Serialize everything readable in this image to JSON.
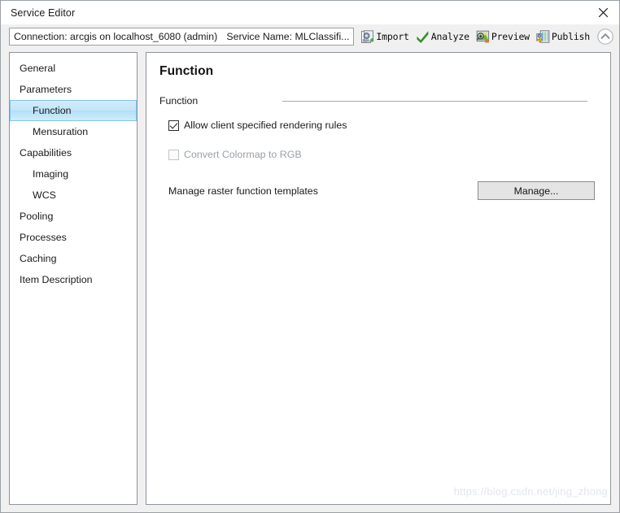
{
  "window": {
    "title": "Service Editor",
    "close_icon": "close-icon"
  },
  "toolbar": {
    "connection_label": "Connection: arcgis on localhost_6080 (admin)",
    "service_name_label": "Service Name: MLClassifi...",
    "buttons": [
      {
        "label": "Import",
        "icon": "import-icon"
      },
      {
        "label": "Analyze",
        "icon": "analyze-check-icon"
      },
      {
        "label": "Preview",
        "icon": "preview-icon"
      },
      {
        "label": "Publish",
        "icon": "publish-icon"
      }
    ],
    "collapse_icon": "chevron-up-circle-icon"
  },
  "sidebar": {
    "items": [
      {
        "label": "General",
        "indent": false,
        "selected": false
      },
      {
        "label": "Parameters",
        "indent": false,
        "selected": false
      },
      {
        "label": "Function",
        "indent": true,
        "selected": true
      },
      {
        "label": "Mensuration",
        "indent": true,
        "selected": false
      },
      {
        "label": "Capabilities",
        "indent": false,
        "selected": false
      },
      {
        "label": "Imaging",
        "indent": true,
        "selected": false
      },
      {
        "label": "WCS",
        "indent": true,
        "selected": false
      },
      {
        "label": "Pooling",
        "indent": false,
        "selected": false
      },
      {
        "label": "Processes",
        "indent": false,
        "selected": false
      },
      {
        "label": "Caching",
        "indent": false,
        "selected": false
      },
      {
        "label": "Item Description",
        "indent": false,
        "selected": false
      }
    ]
  },
  "panel": {
    "title": "Function",
    "group_label": "Function",
    "checkbox_rendering_rules": {
      "label": "Allow client specified rendering rules",
      "checked": true,
      "enabled": true
    },
    "checkbox_convert_colormap": {
      "label": "Convert Colormap to RGB",
      "checked": false,
      "enabled": false
    },
    "manage_templates": {
      "label": "Manage raster function templates",
      "button_label": "Manage..."
    }
  },
  "watermark": {
    "text": "https://blog.csdn.net/jing_zhong"
  },
  "colors": {
    "selection_blue": "#b3def6",
    "selection_border": "#7fc4e8",
    "window_chrome": "#f0f0f0",
    "panel_border": "#8f959e",
    "button_face": "#e4e4e4",
    "disabled_text": "#9aa0a6",
    "accent_green": "#3a9b32",
    "watermark_gray": "#e3e6ef"
  }
}
